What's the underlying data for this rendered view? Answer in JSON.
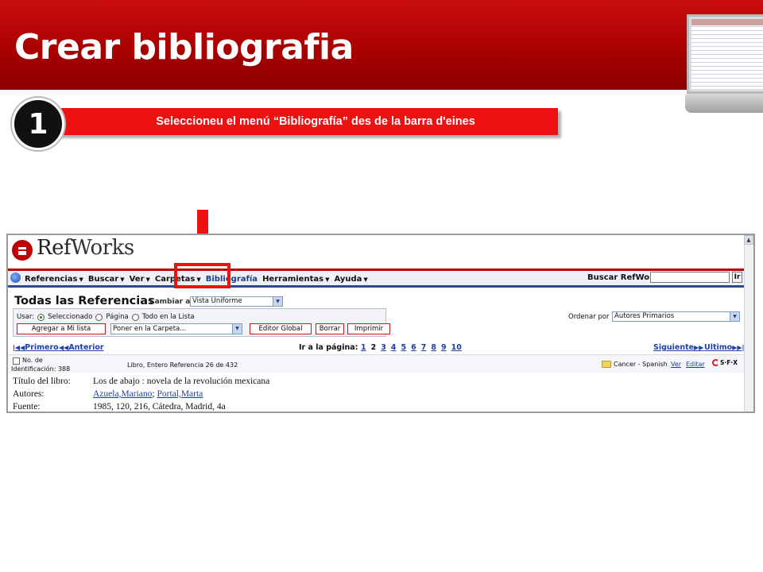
{
  "slide": {
    "title": "Crear bibliografia",
    "step_number": "1",
    "step_text": "Seleccioneu el menú “Bibliografía” des de la barra d'eines"
  },
  "app": {
    "logo_ref": "Ref",
    "logo_works": "Works",
    "nav": [
      {
        "label": "Referencias",
        "caret": true
      },
      {
        "label": "Buscar",
        "caret": true
      },
      {
        "label": "Ver",
        "caret": true
      },
      {
        "label": "Carpetas",
        "caret": true
      },
      {
        "label": "Bibliografía",
        "caret": false
      },
      {
        "label": "Herramientas",
        "caret": true
      },
      {
        "label": "Ayuda",
        "caret": true
      }
    ],
    "search_label": "Buscar RefWorks",
    "search_value": "",
    "search_go": "Ir",
    "page_title": "Todas las Referencias",
    "cambiar_label": "Cambiar a:",
    "view_select": "Vista Uniforme",
    "usar_label": "Usar:",
    "usar_options": [
      "Seleccionado",
      "Página",
      "Todo en la Lista"
    ],
    "usar_selected": "Seleccionado",
    "buttons": {
      "add_list": "Agregar a Mi lista",
      "folder_select": "Poner en la Carpeta...",
      "global_editor": "Editor Global",
      "delete": "Borrar",
      "print": "Imprimir"
    },
    "ordenar_label": "Ordenar por",
    "sort_select": "Autores Primarios",
    "pager": {
      "first": "Primero",
      "prev": "Anterior",
      "goto_label": "Ir a la página:",
      "pages": [
        "1",
        "2",
        "3",
        "4",
        "5",
        "6",
        "7",
        "8",
        "9",
        "10"
      ],
      "current_page": "2",
      "next": "Siguiente",
      "last": "Ultimo"
    },
    "record": {
      "id_label_1": "No. de",
      "id_label_2": "Identificación: 388",
      "type_info": "Libro, Entero Referencia 26 de 432",
      "folder": "Cancer - Spanish",
      "view_link": "Ver",
      "edit_link": "Editar",
      "sfx": "S·F·X",
      "fields": {
        "title_label": "Título del libro:",
        "title_value": "Los de abajo : novela de la revolución mexicana",
        "authors_label": "Autores:",
        "author_1": "Azuela,Mariano",
        "author_sep": ";",
        "author_2": "Portal,Marta",
        "source_label": "Fuente:",
        "source_value": "1985, 120, 216, Cátedra, Madrid, 4a"
      }
    }
  },
  "colors": {
    "header_red": "#a90000",
    "banner_red": "#ee1111",
    "link_blue": "#1d3fa6",
    "nav_blue": "#2f4c8a"
  },
  "icons": [
    "laptop-thumbnail",
    "arrow-down-icon",
    "refworks-logo-icon",
    "globe-icon",
    "folder-icon",
    "sfx-icon"
  ]
}
